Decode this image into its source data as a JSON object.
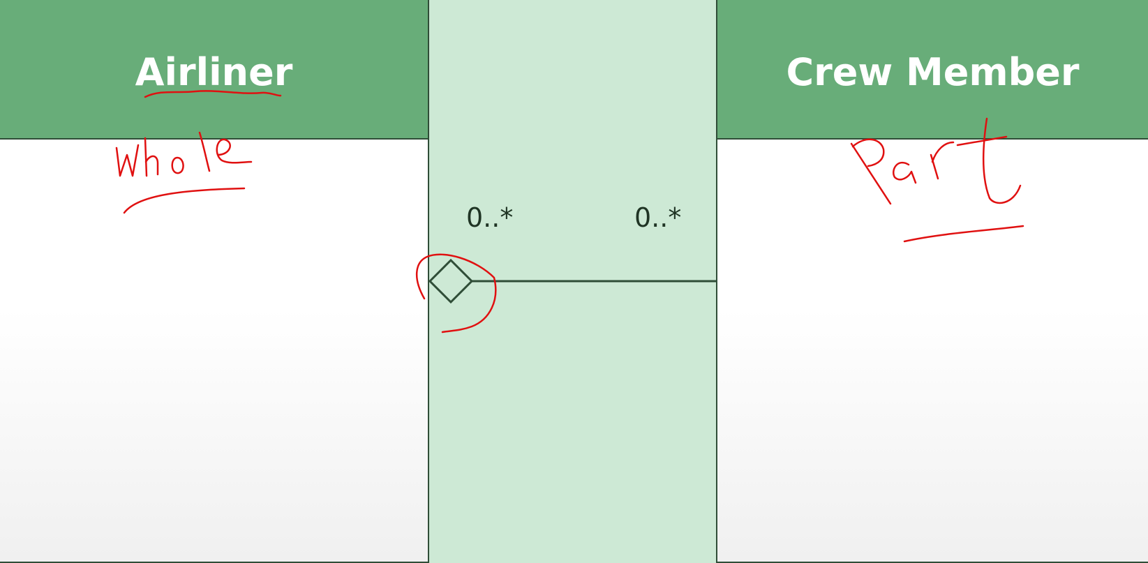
{
  "diagram": {
    "left_class": {
      "name": "Airliner"
    },
    "right_class": {
      "name": "Crew Member"
    },
    "association": {
      "type": "aggregation",
      "diamond_end": "left",
      "left_multiplicity": "0..*",
      "right_multiplicity": "0..*"
    }
  },
  "annotations": {
    "left_note": "whole",
    "right_note": "Part",
    "ink_color": "#e01010"
  },
  "colors": {
    "header": "#68ad79",
    "gap": "#cde9d5",
    "line": "#2f4d37",
    "header_text": "#ffffff"
  }
}
